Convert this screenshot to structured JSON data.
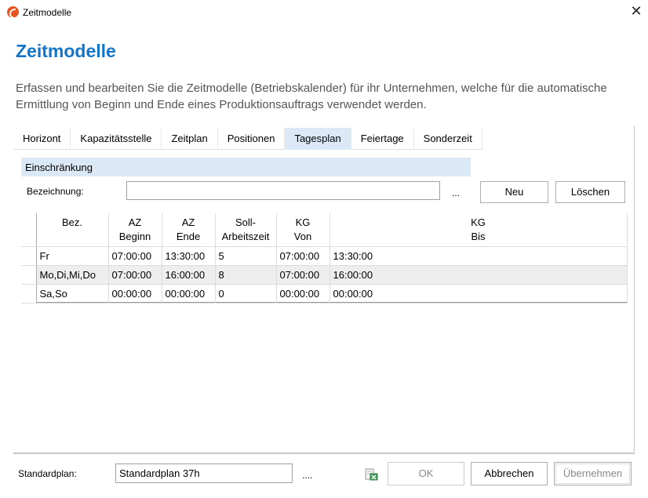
{
  "window": {
    "title": "Zeitmodelle",
    "close_glyph": "✕"
  },
  "header": {
    "title": "Zeitmodelle",
    "description": "Erfassen und bearbeiten Sie die Zeitmodelle (Betriebskalender) für ihr Unternehmen, welche für die automatische Ermittlung von Beginn und Ende eines Produktionsauftrags verwendet werden."
  },
  "tabs": [
    {
      "label": "Horizont",
      "active": false
    },
    {
      "label": "Kapazitätsstelle",
      "active": false
    },
    {
      "label": "Zeitplan",
      "active": false
    },
    {
      "label": "Positionen",
      "active": false
    },
    {
      "label": "Tagesplan",
      "active": true
    },
    {
      "label": "Feiertage",
      "active": false
    },
    {
      "label": "Sonderzeit",
      "active": false
    }
  ],
  "section": {
    "title": "Einschränkung"
  },
  "filter": {
    "label": "Bezeichnung:",
    "value": "",
    "ellipsis": "...",
    "new_button": "Neu",
    "delete_button": "Löschen"
  },
  "grid": {
    "columns": [
      {
        "line1": "Bez.",
        "line2": ""
      },
      {
        "line1": "AZ",
        "line2": "Beginn"
      },
      {
        "line1": "AZ",
        "line2": "Ende"
      },
      {
        "line1": "Soll-",
        "line2": "Arbeitszeit"
      },
      {
        "line1": "KG",
        "line2": "Von"
      },
      {
        "line1": "KG",
        "line2": "Bis"
      }
    ],
    "rows": [
      [
        "Fr",
        "07:00:00",
        "13:30:00",
        "5",
        "07:00:00",
        "13:30:00"
      ],
      [
        "Mo,Di,Mi,Do",
        "07:00:00",
        "16:00:00",
        "8",
        "07:00:00",
        "16:00:00"
      ],
      [
        "Sa,So",
        "00:00:00",
        "00:00:00",
        "0",
        "00:00:00",
        "00:00:00"
      ]
    ]
  },
  "footer": {
    "standardplan_label": "Standardplan:",
    "standardplan_value": "Standardplan 37h",
    "ellipsis": "....",
    "ok_button": "OK",
    "cancel_button": "Abbrechen",
    "apply_button": "Übernehmen",
    "accent_color": "#1376c8",
    "selected_tab_color": "#dbe9f7",
    "excel_icon": "excel-export-icon"
  }
}
